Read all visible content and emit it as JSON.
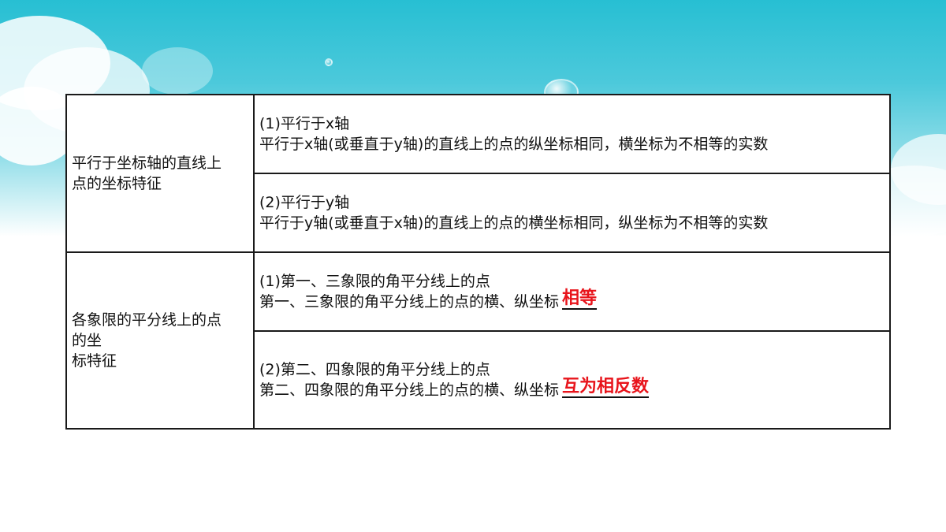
{
  "table": {
    "section1": {
      "label_line1": "平行于坐标轴的直线上",
      "label_line2": "点的坐标特征",
      "item1_title": "(1)平行于x轴",
      "item1_desc": "平行于x轴(或垂直于y轴)的直线上的点的纵坐标相同，横坐标为不相等的实数",
      "item2_title": "(2)平行于y轴",
      "item2_desc": "平行于y轴(或垂直于x轴)的直线上的点的横坐标相同，纵坐标为不相等的实数"
    },
    "section2": {
      "label_line1": "各象限的平分线上的点",
      "label_line2": "的坐",
      "label_line3": "标特征",
      "item1_title": "(1)第一、三象限的角平分线上的点",
      "item1_desc": "第一、三象限的角平分线上的点的横、纵坐标",
      "item1_answer": "相等",
      "item2_title": "(2)第二、四象限的角平分线上的点",
      "item2_desc": "第二、四象限的角平分线上的点的横、纵坐标",
      "item2_answer": "互为相反数"
    }
  },
  "colors": {
    "answer": "#e8141b",
    "border": "#1a1a1a",
    "sky": "#27bfd3"
  }
}
